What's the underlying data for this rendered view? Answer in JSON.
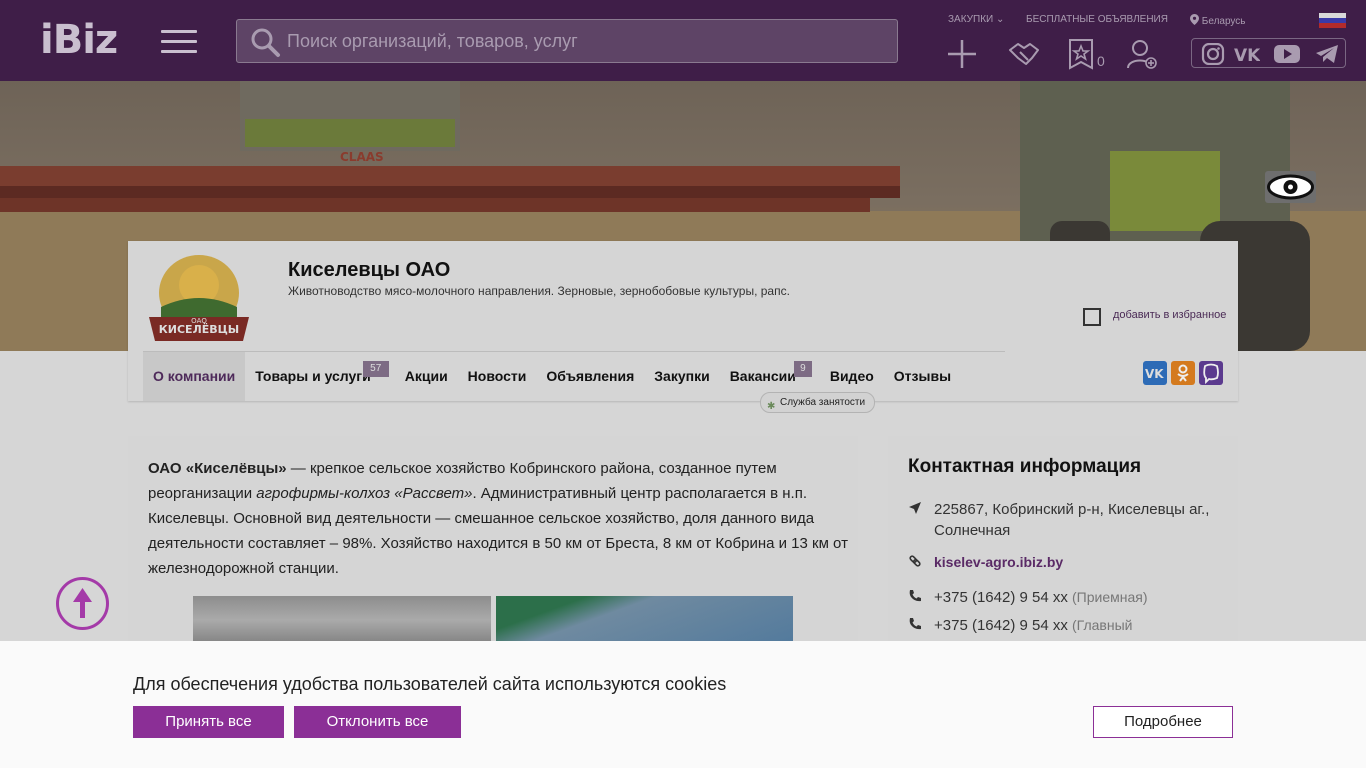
{
  "header": {
    "logo_text": "iBiz",
    "search_placeholder": "Поиск организаций, товаров, услуг",
    "nav": {
      "purchases": "ЗАКУПКИ",
      "free_ads": "БЕСПЛАТНЫЕ ОБЪЯВЛЕНИЯ",
      "region": "Беларусь"
    },
    "favorites_count": "0"
  },
  "company": {
    "name": "Киселевцы ОАО",
    "description": "Животноводство мясо-молочного направления. Зерновые, зернобобовые культуры, рапс.",
    "logo_text": "КИСЕЛЁВЦЫ",
    "logo_subtext": "ОАО",
    "add_favorite": "добавить в избранное",
    "tabs": [
      {
        "label": "О компании"
      },
      {
        "label": "Товары и услуги",
        "badge": "57"
      },
      {
        "label": "Акции"
      },
      {
        "label": "Новости"
      },
      {
        "label": "Объявления"
      },
      {
        "label": "Закупки"
      },
      {
        "label": "Вакансии",
        "badge": "9"
      },
      {
        "label": "Видео"
      },
      {
        "label": "Отзывы"
      }
    ],
    "vacancy_tip": "Служба занятости"
  },
  "about": {
    "company_quote": "ОАО «Киселёвцы»",
    "text_1": " — крепкое сельское хозяйство Кобринского района, созданное путем реорганизации ",
    "italic": "агрофирмы-колхоз «Рассвет»",
    "text_2": ". Административный центр располагается в н.п. Киселевцы. Основной вид деятельности — смешанное сельское хозяйство, доля данного вида деятельности составляет – 98%. Хозяйство находится в 50 км от Бреста, 8 км от Кобрина и 13 км от железнодорожной станции."
  },
  "contacts": {
    "title": "Контактная информация",
    "address": "225867, Кобринский р-н, Киселевцы аг., Солнечная",
    "site": "kiselev-agro.ibiz.by",
    "phone_1": "+375 (1642) 9 54 xx",
    "phone_1_note": "(Приемная)",
    "phone_2": "+375 (1642) 9 54 xx",
    "phone_2_note": "(Главный"
  },
  "cookie": {
    "text": "Для обеспечения удобства пользователей сайта используются cookies",
    "accept": "Принять все",
    "decline": "Отклонить все",
    "more": "Подробнее"
  },
  "colors": {
    "header_bg": "#3f1e48",
    "accent": "#8b2f96",
    "link": "#5a2a66"
  }
}
